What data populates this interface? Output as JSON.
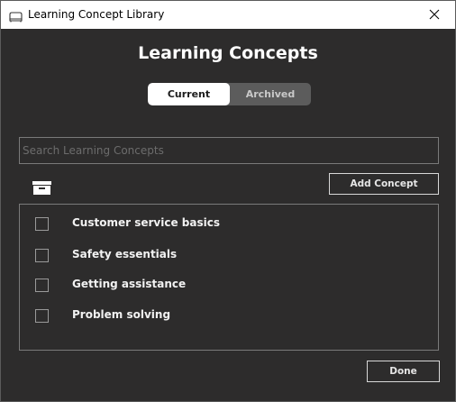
{
  "window": {
    "title": "Learning Concept Library",
    "app_icon": "library-icon",
    "close_icon": "close-icon"
  },
  "main": {
    "heading": "Learning Concepts",
    "tabs": [
      {
        "label": "Current",
        "selected": true
      },
      {
        "label": "Archived",
        "selected": false
      }
    ],
    "search": {
      "placeholder": "Search Learning Concepts",
      "value": ""
    },
    "archive_icon": "archive-box-icon",
    "add_button_label": "Add Concept",
    "concepts": [
      {
        "label": "Customer service basics",
        "checked": false
      },
      {
        "label": "Safety essentials",
        "checked": false
      },
      {
        "label": "Getting assistance",
        "checked": false
      },
      {
        "label": "Problem solving",
        "checked": false
      }
    ],
    "done_button_label": "Done"
  },
  "colors": {
    "background": "#2d2c2c",
    "titlebar": "#ffffff",
    "toggle_track": "#5c5c5c",
    "toggle_selected": "#ffffff",
    "text_primary": "#f2f2f2",
    "border": "#7a7a7a"
  }
}
